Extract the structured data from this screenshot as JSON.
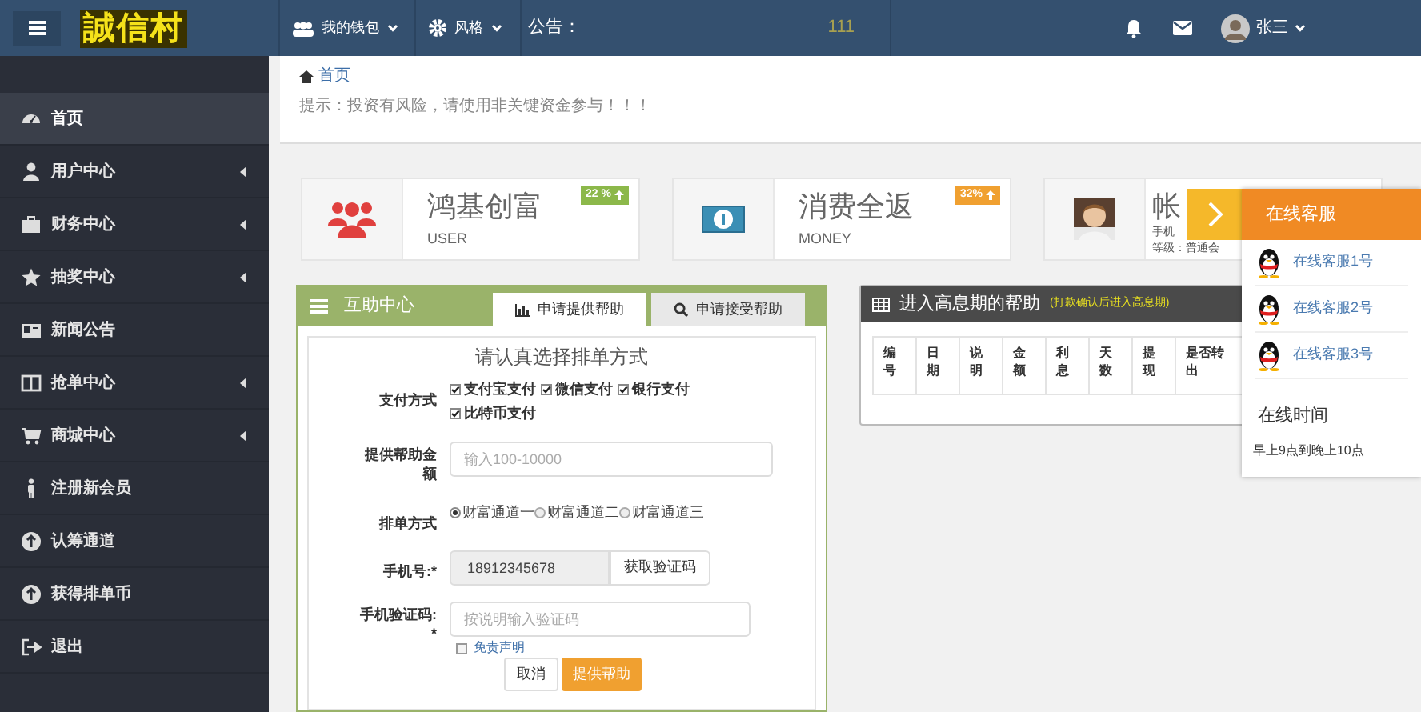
{
  "topbar": {
    "logo": "誠信村",
    "menus": [
      {
        "label": "我的钱包"
      },
      {
        "label": "风格"
      }
    ],
    "notice_label": "公告：",
    "notice_text": "111",
    "user": "张三"
  },
  "sidebar": {
    "items": [
      {
        "label": "首页",
        "selected": true,
        "has_submenu": false
      },
      {
        "label": "用户中心",
        "selected": false,
        "has_submenu": true
      },
      {
        "label": "财务中心",
        "selected": false,
        "has_submenu": true
      },
      {
        "label": "抽奖中心",
        "selected": false,
        "has_submenu": true
      },
      {
        "label": "新闻公告",
        "selected": false,
        "has_submenu": false
      },
      {
        "label": "抢单中心",
        "selected": false,
        "has_submenu": true
      },
      {
        "label": "商城中心",
        "selected": false,
        "has_submenu": true
      },
      {
        "label": "注册新会员",
        "selected": false,
        "has_submenu": false
      },
      {
        "label": "认筹通道",
        "selected": false,
        "has_submenu": false
      },
      {
        "label": "获得排单币",
        "selected": false,
        "has_submenu": false
      },
      {
        "label": "退出",
        "selected": false,
        "has_submenu": false
      }
    ]
  },
  "breadcrumb": "首页",
  "tip": "提示：投资有风险，请使用非关键资金参与！！！",
  "cards": [
    {
      "title": "鸿基创富",
      "subtitle": "USER",
      "badge": "22 %",
      "color": "#8cb84a"
    },
    {
      "title": "消费全返",
      "subtitle": "MONEY",
      "badge": "32%",
      "color": "#f0a030"
    },
    {
      "title": "帐",
      "lines": [
        "手机",
        "等级：普通会"
      ]
    }
  ],
  "help_panel": {
    "title": "互助中心",
    "tabs": [
      {
        "label": "申请提供帮助",
        "selected": true
      },
      {
        "label": "申请接受帮助",
        "selected": false
      }
    ],
    "heading": "请认真选择排单方式",
    "payment_label": "支付方式",
    "payments": [
      {
        "label": "支付宝支付",
        "checked": true
      },
      {
        "label": "微信支付",
        "checked": true
      },
      {
        "label": "银行支付",
        "checked": true
      },
      {
        "label": "比特币支付",
        "checked": true
      }
    ],
    "amount_label": "提供帮助金额",
    "amount_placeholder": "输入100-10000",
    "queue_label": "排单方式",
    "queues": [
      {
        "label": "财富通道一",
        "selected": true
      },
      {
        "label": "财富通道二",
        "selected": false
      },
      {
        "label": "财富通道三",
        "selected": false
      }
    ],
    "phone_label": "手机号:",
    "phone_required": "*",
    "phone_value": "18912345678",
    "code_button": "获取验证码",
    "code_label": "手机验证码:",
    "code_required": "*",
    "code_placeholder": "按说明输入验证码",
    "disclaimer": {
      "label": "免责声明",
      "checked": false
    },
    "buttons": [
      "取消",
      "提供帮助"
    ]
  },
  "interest_panel": {
    "title": "进入高息期的帮助",
    "note": "(打款确认后进入高息期)",
    "columns": [
      "编号",
      "日期",
      "说明",
      "金额",
      "利息",
      "天数",
      "提现",
      "是否转出"
    ]
  },
  "service_panel": {
    "title": "在线客服",
    "agents": [
      "在线客服1号",
      "在线客服2号",
      "在线客服3号"
    ],
    "hours_title": "在线时间",
    "hours": "早上9点到晚上10点"
  }
}
